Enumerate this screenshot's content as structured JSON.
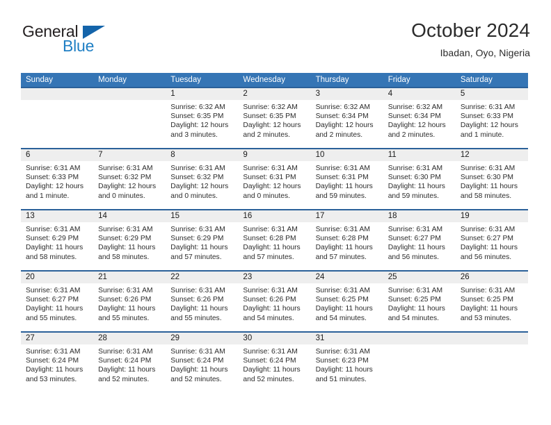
{
  "brand": {
    "name_top": "General",
    "name_bottom": "Blue",
    "accent_color": "#1f7fc4",
    "triangle_color": "#1464aa"
  },
  "header": {
    "title": "October 2024",
    "subtitle": "Ibadan, Oyo, Nigeria"
  },
  "calendar": {
    "header_color": "#3575b5",
    "row_separator_color": "#2a6099",
    "day_band_color": "#eeeeee",
    "weekdays": [
      "Sunday",
      "Monday",
      "Tuesday",
      "Wednesday",
      "Thursday",
      "Friday",
      "Saturday"
    ],
    "weeks": [
      [
        {
          "day": "",
          "lines": []
        },
        {
          "day": "",
          "lines": []
        },
        {
          "day": "1",
          "lines": [
            "Sunrise: 6:32 AM",
            "Sunset: 6:35 PM",
            "Daylight: 12 hours",
            "and 3 minutes."
          ]
        },
        {
          "day": "2",
          "lines": [
            "Sunrise: 6:32 AM",
            "Sunset: 6:35 PM",
            "Daylight: 12 hours",
            "and 2 minutes."
          ]
        },
        {
          "day": "3",
          "lines": [
            "Sunrise: 6:32 AM",
            "Sunset: 6:34 PM",
            "Daylight: 12 hours",
            "and 2 minutes."
          ]
        },
        {
          "day": "4",
          "lines": [
            "Sunrise: 6:32 AM",
            "Sunset: 6:34 PM",
            "Daylight: 12 hours",
            "and 2 minutes."
          ]
        },
        {
          "day": "5",
          "lines": [
            "Sunrise: 6:31 AM",
            "Sunset: 6:33 PM",
            "Daylight: 12 hours",
            "and 1 minute."
          ]
        }
      ],
      [
        {
          "day": "6",
          "lines": [
            "Sunrise: 6:31 AM",
            "Sunset: 6:33 PM",
            "Daylight: 12 hours",
            "and 1 minute."
          ]
        },
        {
          "day": "7",
          "lines": [
            "Sunrise: 6:31 AM",
            "Sunset: 6:32 PM",
            "Daylight: 12 hours",
            "and 0 minutes."
          ]
        },
        {
          "day": "8",
          "lines": [
            "Sunrise: 6:31 AM",
            "Sunset: 6:32 PM",
            "Daylight: 12 hours",
            "and 0 minutes."
          ]
        },
        {
          "day": "9",
          "lines": [
            "Sunrise: 6:31 AM",
            "Sunset: 6:31 PM",
            "Daylight: 12 hours",
            "and 0 minutes."
          ]
        },
        {
          "day": "10",
          "lines": [
            "Sunrise: 6:31 AM",
            "Sunset: 6:31 PM",
            "Daylight: 11 hours",
            "and 59 minutes."
          ]
        },
        {
          "day": "11",
          "lines": [
            "Sunrise: 6:31 AM",
            "Sunset: 6:30 PM",
            "Daylight: 11 hours",
            "and 59 minutes."
          ]
        },
        {
          "day": "12",
          "lines": [
            "Sunrise: 6:31 AM",
            "Sunset: 6:30 PM",
            "Daylight: 11 hours",
            "and 58 minutes."
          ]
        }
      ],
      [
        {
          "day": "13",
          "lines": [
            "Sunrise: 6:31 AM",
            "Sunset: 6:29 PM",
            "Daylight: 11 hours",
            "and 58 minutes."
          ]
        },
        {
          "day": "14",
          "lines": [
            "Sunrise: 6:31 AM",
            "Sunset: 6:29 PM",
            "Daylight: 11 hours",
            "and 58 minutes."
          ]
        },
        {
          "day": "15",
          "lines": [
            "Sunrise: 6:31 AM",
            "Sunset: 6:29 PM",
            "Daylight: 11 hours",
            "and 57 minutes."
          ]
        },
        {
          "day": "16",
          "lines": [
            "Sunrise: 6:31 AM",
            "Sunset: 6:28 PM",
            "Daylight: 11 hours",
            "and 57 minutes."
          ]
        },
        {
          "day": "17",
          "lines": [
            "Sunrise: 6:31 AM",
            "Sunset: 6:28 PM",
            "Daylight: 11 hours",
            "and 57 minutes."
          ]
        },
        {
          "day": "18",
          "lines": [
            "Sunrise: 6:31 AM",
            "Sunset: 6:27 PM",
            "Daylight: 11 hours",
            "and 56 minutes."
          ]
        },
        {
          "day": "19",
          "lines": [
            "Sunrise: 6:31 AM",
            "Sunset: 6:27 PM",
            "Daylight: 11 hours",
            "and 56 minutes."
          ]
        }
      ],
      [
        {
          "day": "20",
          "lines": [
            "Sunrise: 6:31 AM",
            "Sunset: 6:27 PM",
            "Daylight: 11 hours",
            "and 55 minutes."
          ]
        },
        {
          "day": "21",
          "lines": [
            "Sunrise: 6:31 AM",
            "Sunset: 6:26 PM",
            "Daylight: 11 hours",
            "and 55 minutes."
          ]
        },
        {
          "day": "22",
          "lines": [
            "Sunrise: 6:31 AM",
            "Sunset: 6:26 PM",
            "Daylight: 11 hours",
            "and 55 minutes."
          ]
        },
        {
          "day": "23",
          "lines": [
            "Sunrise: 6:31 AM",
            "Sunset: 6:26 PM",
            "Daylight: 11 hours",
            "and 54 minutes."
          ]
        },
        {
          "day": "24",
          "lines": [
            "Sunrise: 6:31 AM",
            "Sunset: 6:25 PM",
            "Daylight: 11 hours",
            "and 54 minutes."
          ]
        },
        {
          "day": "25",
          "lines": [
            "Sunrise: 6:31 AM",
            "Sunset: 6:25 PM",
            "Daylight: 11 hours",
            "and 54 minutes."
          ]
        },
        {
          "day": "26",
          "lines": [
            "Sunrise: 6:31 AM",
            "Sunset: 6:25 PM",
            "Daylight: 11 hours",
            "and 53 minutes."
          ]
        }
      ],
      [
        {
          "day": "27",
          "lines": [
            "Sunrise: 6:31 AM",
            "Sunset: 6:24 PM",
            "Daylight: 11 hours",
            "and 53 minutes."
          ]
        },
        {
          "day": "28",
          "lines": [
            "Sunrise: 6:31 AM",
            "Sunset: 6:24 PM",
            "Daylight: 11 hours",
            "and 52 minutes."
          ]
        },
        {
          "day": "29",
          "lines": [
            "Sunrise: 6:31 AM",
            "Sunset: 6:24 PM",
            "Daylight: 11 hours",
            "and 52 minutes."
          ]
        },
        {
          "day": "30",
          "lines": [
            "Sunrise: 6:31 AM",
            "Sunset: 6:24 PM",
            "Daylight: 11 hours",
            "and 52 minutes."
          ]
        },
        {
          "day": "31",
          "lines": [
            "Sunrise: 6:31 AM",
            "Sunset: 6:23 PM",
            "Daylight: 11 hours",
            "and 51 minutes."
          ]
        },
        {
          "day": "",
          "lines": []
        },
        {
          "day": "",
          "lines": []
        }
      ]
    ]
  }
}
